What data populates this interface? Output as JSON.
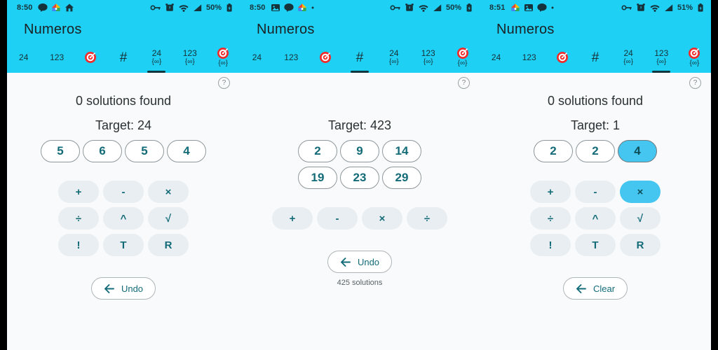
{
  "theme": {
    "appbar_color": "#1fd0f5",
    "accent_color": "#45c6f0",
    "chip_text_color": "#136b78",
    "page_bg": "#f8fafc",
    "bezel_color": "#000000"
  },
  "tabs_template": [
    {
      "label": "24",
      "sub": "",
      "icon": ""
    },
    {
      "label": "123",
      "sub": "",
      "icon": ""
    },
    {
      "label": "",
      "sub": "",
      "icon": "target-icon"
    },
    {
      "label": "#",
      "sub": "",
      "icon": ""
    },
    {
      "label": "24",
      "sub": "{∞}",
      "icon": ""
    },
    {
      "label": "123",
      "sub": "{∞}",
      "icon": ""
    },
    {
      "label": "",
      "sub": "{∞}",
      "icon": "target-icon"
    }
  ],
  "panels": [
    {
      "id": "panel-1",
      "status": {
        "time": "8:50",
        "left_icons": [
          "message-icon",
          "google-home-icon",
          "home-icon"
        ],
        "right_icons": [
          "vpn-key-icon",
          "alarm-icon",
          "wifi-icon",
          "signal-icon"
        ],
        "battery_percent": "50%",
        "battery_icon": "battery-icon"
      },
      "appbar": {
        "title": "Numeros"
      },
      "selected_tab_index": 4,
      "help_label": "?",
      "solutions_found": "0 solutions found",
      "target_label": "Target: 24",
      "numbers": [
        {
          "value": "5",
          "selected": false
        },
        {
          "value": "6",
          "selected": false
        },
        {
          "value": "5",
          "selected": false
        },
        {
          "value": "4",
          "selected": false
        }
      ],
      "operator_rows": [
        [
          {
            "label": "+",
            "selected": false
          },
          {
            "label": "-",
            "selected": false
          },
          {
            "label": "×",
            "selected": false
          }
        ],
        [
          {
            "label": "÷",
            "selected": false
          },
          {
            "label": "^",
            "selected": false
          },
          {
            "label": "√",
            "selected": false
          }
        ],
        [
          {
            "label": "!",
            "selected": false
          },
          {
            "label": "T",
            "selected": false
          },
          {
            "label": "R",
            "selected": false
          }
        ]
      ],
      "action": {
        "label": "Undo",
        "icon": "back-arrow-icon"
      },
      "sub_note": ""
    },
    {
      "id": "panel-2",
      "status": {
        "time": "8:50",
        "left_icons": [
          "photos-icon",
          "message-icon",
          "google-home-icon",
          "dot-icon"
        ],
        "right_icons": [
          "vpn-key-icon",
          "alarm-icon",
          "wifi-icon",
          "signal-icon"
        ],
        "battery_percent": "50%",
        "battery_icon": "battery-icon"
      },
      "appbar": {
        "title": "Numeros"
      },
      "selected_tab_index": 3,
      "help_label": "?",
      "solutions_found": "",
      "target_label": "Target: 423",
      "numbers": [
        {
          "value": "2",
          "selected": false
        },
        {
          "value": "9",
          "selected": false
        },
        {
          "value": "14",
          "selected": false
        },
        {
          "value": "19",
          "selected": false
        },
        {
          "value": "23",
          "selected": false
        },
        {
          "value": "29",
          "selected": false
        }
      ],
      "operator_rows": [
        [
          {
            "label": "+",
            "selected": false
          },
          {
            "label": "-",
            "selected": false
          },
          {
            "label": "×",
            "selected": false
          },
          {
            "label": "÷",
            "selected": false
          }
        ]
      ],
      "action": {
        "label": "Undo",
        "icon": "back-arrow-icon"
      },
      "sub_note": "425 solutions"
    },
    {
      "id": "panel-3",
      "status": {
        "time": "8:51",
        "left_icons": [
          "google-home-icon",
          "photos-icon",
          "message-icon",
          "dot-icon"
        ],
        "right_icons": [
          "vpn-key-icon",
          "alarm-icon",
          "wifi-icon",
          "signal-icon"
        ],
        "battery_percent": "51%",
        "battery_icon": "battery-icon"
      },
      "appbar": {
        "title": "Numeros"
      },
      "selected_tab_index": 5,
      "help_label": "?",
      "solutions_found": "0 solutions found",
      "target_label": "Target: 1",
      "numbers": [
        {
          "value": "2",
          "selected": false
        },
        {
          "value": "2",
          "selected": false
        },
        {
          "value": "4",
          "selected": true
        }
      ],
      "operator_rows": [
        [
          {
            "label": "+",
            "selected": false
          },
          {
            "label": "-",
            "selected": false
          },
          {
            "label": "×",
            "selected": true
          }
        ],
        [
          {
            "label": "÷",
            "selected": false
          },
          {
            "label": "^",
            "selected": false
          },
          {
            "label": "√",
            "selected": false
          }
        ],
        [
          {
            "label": "!",
            "selected": false
          },
          {
            "label": "T",
            "selected": false
          },
          {
            "label": "R",
            "selected": false
          }
        ]
      ],
      "action": {
        "label": "Clear",
        "icon": "back-arrow-icon"
      },
      "sub_note": ""
    }
  ]
}
